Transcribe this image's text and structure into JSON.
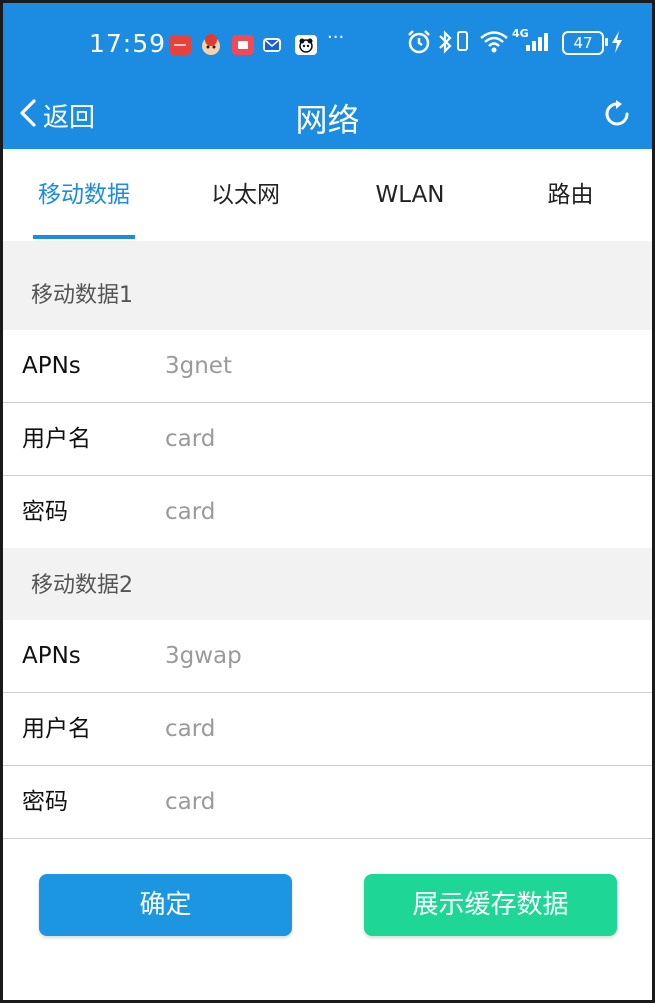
{
  "status_bar": {
    "time": "17:59",
    "notification_icons": [
      "huawei-app-icon",
      "cartoon-app-icon",
      "book-app-icon",
      "mail-icon",
      "panda-app-icon"
    ],
    "more": "···",
    "signal_label": "4G",
    "battery": "47"
  },
  "header": {
    "back_label": "返回",
    "title": "网络"
  },
  "tabs": [
    {
      "label": "移动数据",
      "active": true
    },
    {
      "label": "以太网",
      "active": false
    },
    {
      "label": "WLAN",
      "active": false
    },
    {
      "label": "路由",
      "active": false
    }
  ],
  "sections": [
    {
      "title": "移动数据1",
      "rows": [
        {
          "label": "APNs",
          "placeholder": "3gnet"
        },
        {
          "label": "用户名",
          "placeholder": "card"
        },
        {
          "label": "密码",
          "placeholder": "card"
        }
      ]
    },
    {
      "title": "移动数据2",
      "rows": [
        {
          "label": "APNs",
          "placeholder": "3gwap"
        },
        {
          "label": "用户名",
          "placeholder": "card"
        },
        {
          "label": "密码",
          "placeholder": "card"
        }
      ]
    }
  ],
  "buttons": {
    "confirm": "确定",
    "show_cache": "展示缓存数据"
  },
  "colors": {
    "primary": "#1c8ce3",
    "confirm_button": "#1c96e0",
    "cache_button": "#1ed797",
    "section_bg": "#f2f2f2"
  }
}
